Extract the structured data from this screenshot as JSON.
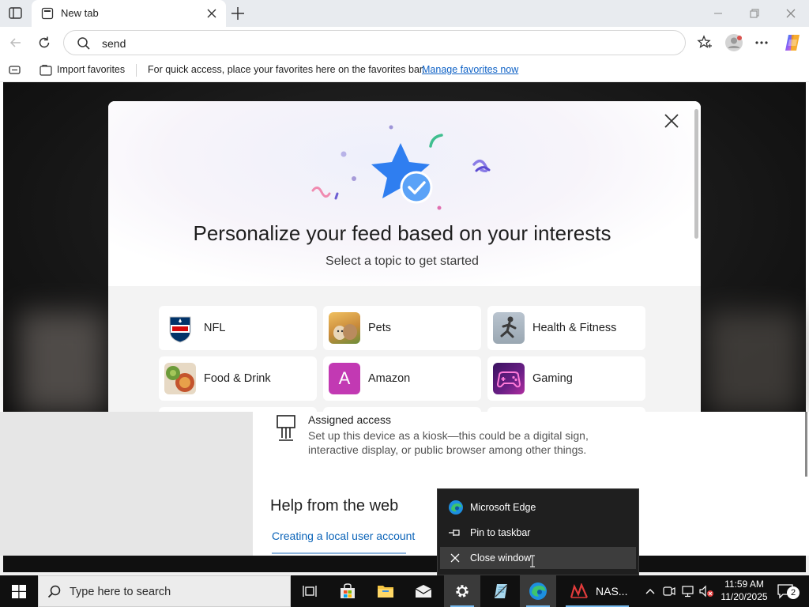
{
  "browser": {
    "tab_title": "New tab",
    "address_value": "send",
    "favorites_bar": {
      "import_label": "Import favorites",
      "message": "For quick access, place your favorites here on the favorites bar.",
      "manage_link": "Manage favorites now"
    }
  },
  "modal": {
    "title": "Personalize your feed based on your interests",
    "subtitle": "Select a topic to get started",
    "topics": [
      {
        "label": "NFL"
      },
      {
        "label": "Pets"
      },
      {
        "label": "Health & Fitness"
      },
      {
        "label": "Food & Drink"
      },
      {
        "label": "Amazon",
        "initial": "A"
      },
      {
        "label": "Gaming"
      }
    ]
  },
  "settings": {
    "assigned_access_title": "Assigned access",
    "assigned_access_desc_1": "Set up this device as a kiosk—this could be a digital sign,",
    "assigned_access_desc_2": "interactive display, or public browser among other things.",
    "help_title": "Help from the web",
    "help_link_1": "Creating a local user account"
  },
  "jumplist": {
    "app_name": "Microsoft Edge",
    "pin_label": "Pin to taskbar",
    "close_label": "Close window"
  },
  "taskbar": {
    "search_placeholder": "Type here to search",
    "nas_label": "NAS...",
    "time": "11:59 AM",
    "date": "11/20/2025",
    "notification_count": "2"
  },
  "colors": {
    "accent_blue": "#0f62c6",
    "amazon_purple": "#c239b3",
    "taskbar_bg": "#101010",
    "jumplist_bg": "#1f1f1f"
  }
}
